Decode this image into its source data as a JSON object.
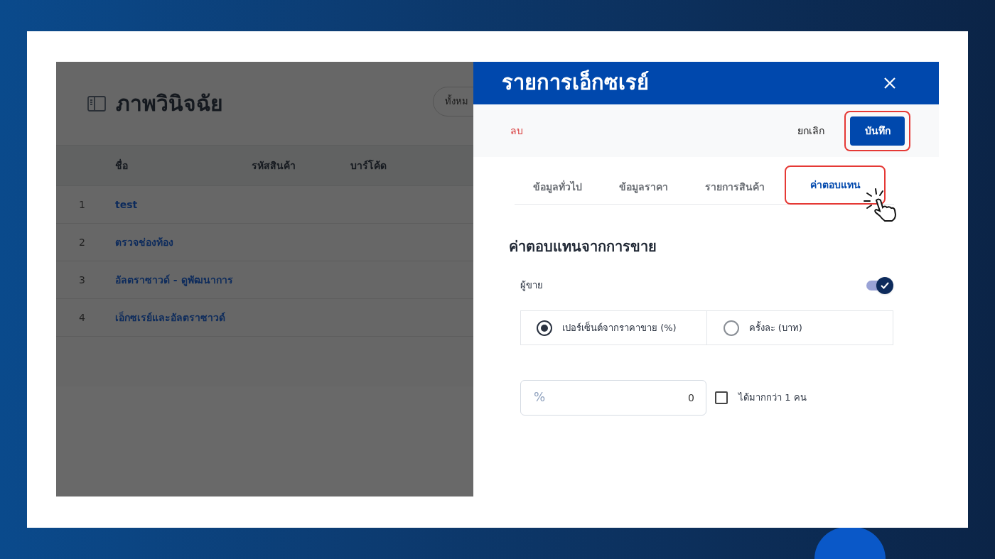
{
  "page": {
    "title": "ภาพวินิจฉัย",
    "filter_button": "ทั้งหม",
    "table": {
      "columns": [
        "",
        "ชื่อ",
        "รหัสสินค้า",
        "บาร์โค้ด"
      ],
      "rows": [
        {
          "index": "1",
          "name": "test"
        },
        {
          "index": "2",
          "name": "ตรวจช่องท้อง"
        },
        {
          "index": "3",
          "name": "อัลตราซาวด์ - ดูพัฒนาการ"
        },
        {
          "index": "4",
          "name": "เอ็กซเรย์และอัลตราซาวด์"
        }
      ]
    }
  },
  "drawer": {
    "title": "รายการเอ็กซเรย์",
    "delete": "ลบ",
    "cancel": "ยกเลิก",
    "save": {
      "label": "บันทึก",
      "highlighted": true
    },
    "tabs": [
      {
        "label": "ข้อมูลทั่วไป",
        "selected": false,
        "highlighted": false
      },
      {
        "label": "ข้อมูลราคา",
        "selected": false,
        "highlighted": false
      },
      {
        "label": "รายการสินค้า",
        "selected": false,
        "highlighted": false
      },
      {
        "label": "ค่าตอบแทน",
        "selected": true,
        "highlighted": true
      }
    ],
    "section_title": "ค่าตอบแทนจากการขาย",
    "seller": {
      "label": "ผู้ขาย",
      "on": true
    },
    "commission_type": [
      {
        "label": "เปอร์เซ็นต์จากราคาขาย (%)",
        "selected": true
      },
      {
        "label": "ครั้งละ (บาท)",
        "selected": false
      }
    ],
    "amount": {
      "prefix": "%",
      "value": "0"
    },
    "multiple": {
      "label": "ได้มากกว่า 1 คน",
      "checked": false
    }
  }
}
